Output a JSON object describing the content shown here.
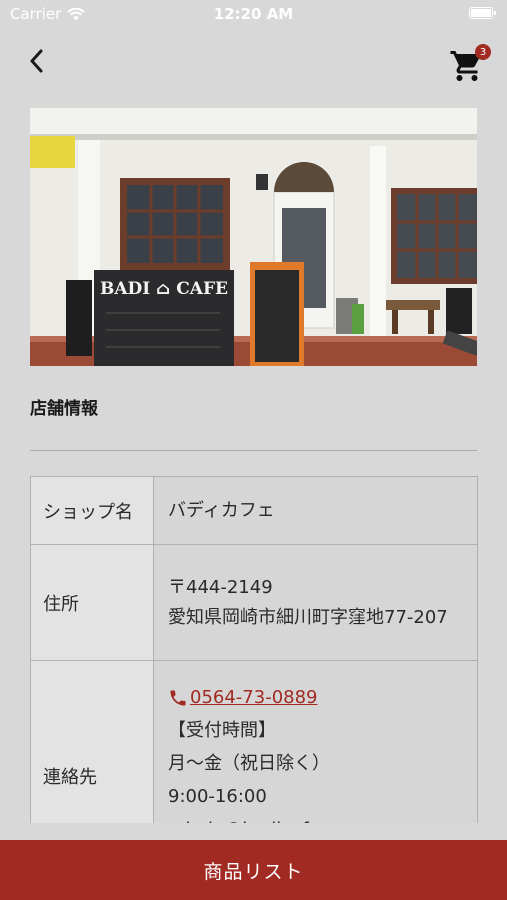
{
  "status_bar": {
    "carrier": "Carrier",
    "time": "12:20 AM",
    "wifi_icon": "wifi-icon",
    "battery_icon": "battery-icon"
  },
  "nav": {
    "back_icon": "chevron-left-icon",
    "cart_icon": "shopping-cart-icon",
    "cart_count": "3"
  },
  "photo": {
    "sign_text": "BADI ⌂ CAFE",
    "description_icon": "shop-photo"
  },
  "section": {
    "title": "店舗情報"
  },
  "table": {
    "shop_label": "ショップ名",
    "shop_value": "バディカフェ",
    "address_label": "住所",
    "postal_code": "〒444-2149",
    "address_line": "愛知県岡崎市細川町字窪地77-207",
    "contact_label": "連絡先",
    "phone_icon": "phone-icon",
    "phone": "0564-73-0889",
    "hours_heading": "【受付時間】",
    "hours_days": "月～金（祝日除く）",
    "hours_time": "9:00-16:00",
    "email": "admin@badicafe.com"
  },
  "bottom": {
    "product_list_label": "商品リスト"
  },
  "colors": {
    "accent": "#a12a22",
    "background": "#d8d8d8"
  }
}
